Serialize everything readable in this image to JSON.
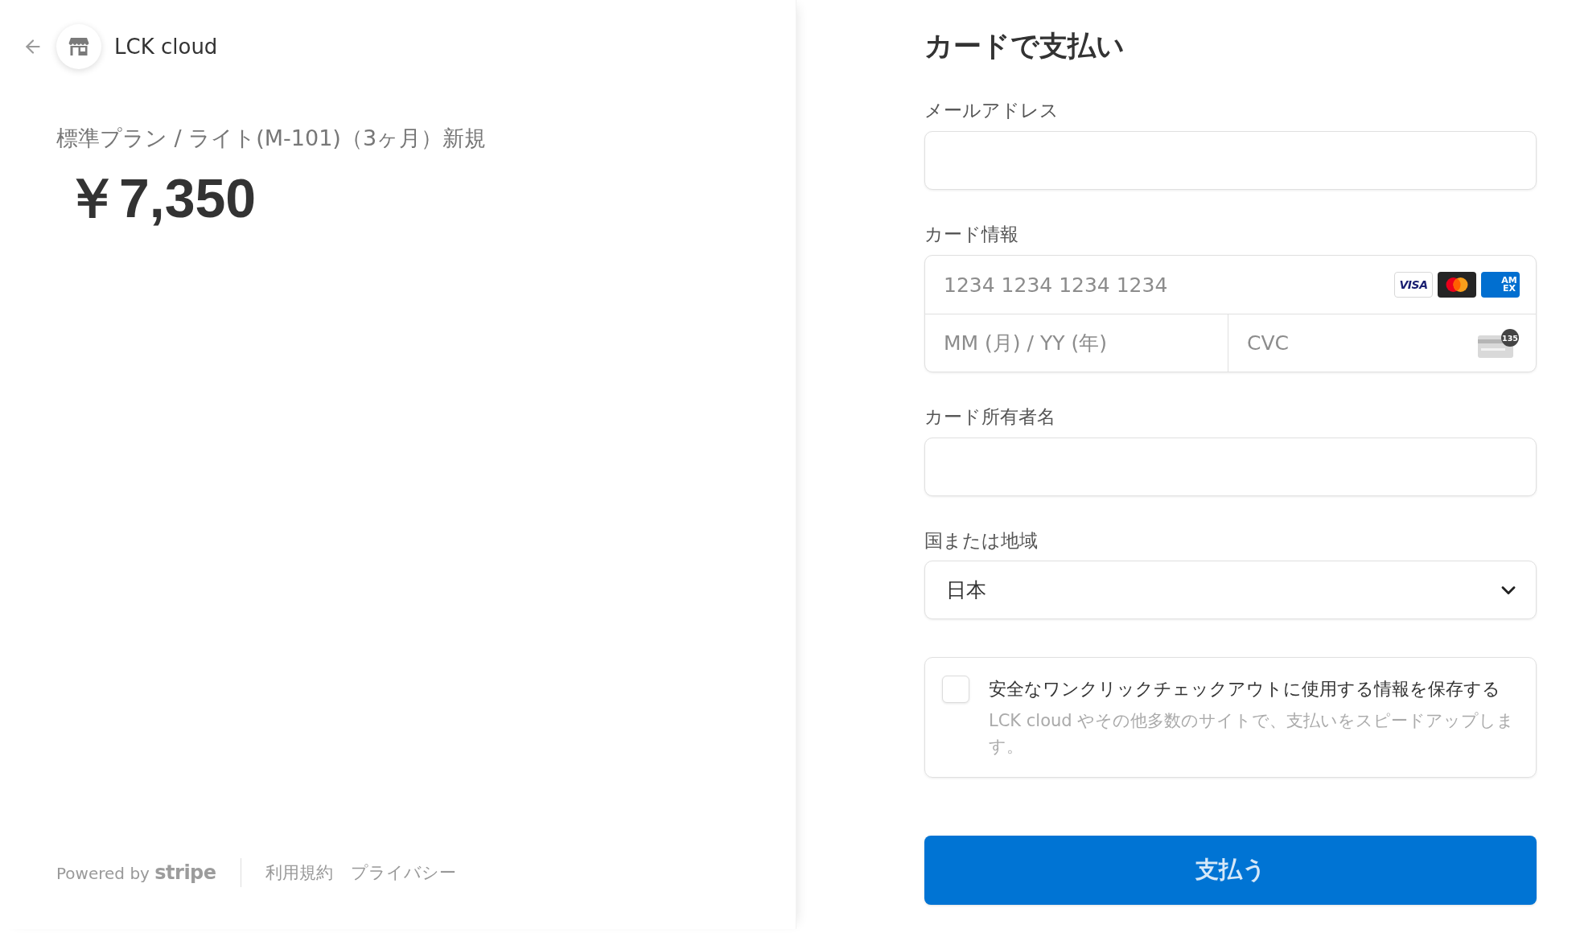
{
  "header": {
    "merchant_name": "LCK cloud"
  },
  "summary": {
    "product": "標準プラン / ライト(M-101)（3ヶ月）新規",
    "price": "￥7,350"
  },
  "footer": {
    "powered_by": "Powered by",
    "brand": "stripe",
    "links": [
      "利用規約",
      "プライバシー"
    ]
  },
  "payment_form": {
    "title": "カードで支払い",
    "email": {
      "label": "メールアドレス"
    },
    "card": {
      "label": "カード情報",
      "number_placeholder": "1234 1234 1234 1234",
      "brands": [
        {
          "kind": "visa",
          "text": "VISA"
        },
        {
          "kind": "mastercard"
        },
        {
          "kind": "amex",
          "text": "AMEX"
        }
      ],
      "expiry_placeholder": "MM (月) / YY (年)",
      "cvc_placeholder": "CVC",
      "cvc_badge": "135"
    },
    "cardholder": {
      "label": "カード所有者名"
    },
    "country": {
      "label": "国または地域",
      "value": "日本"
    },
    "save_info": {
      "checked": false,
      "label": "安全なワンクリックチェックアウトに使用する情報を保存する",
      "description": "LCK cloud やその他多数のサイトで、支払いをスピードアップします。"
    },
    "submit": "支払う"
  }
}
